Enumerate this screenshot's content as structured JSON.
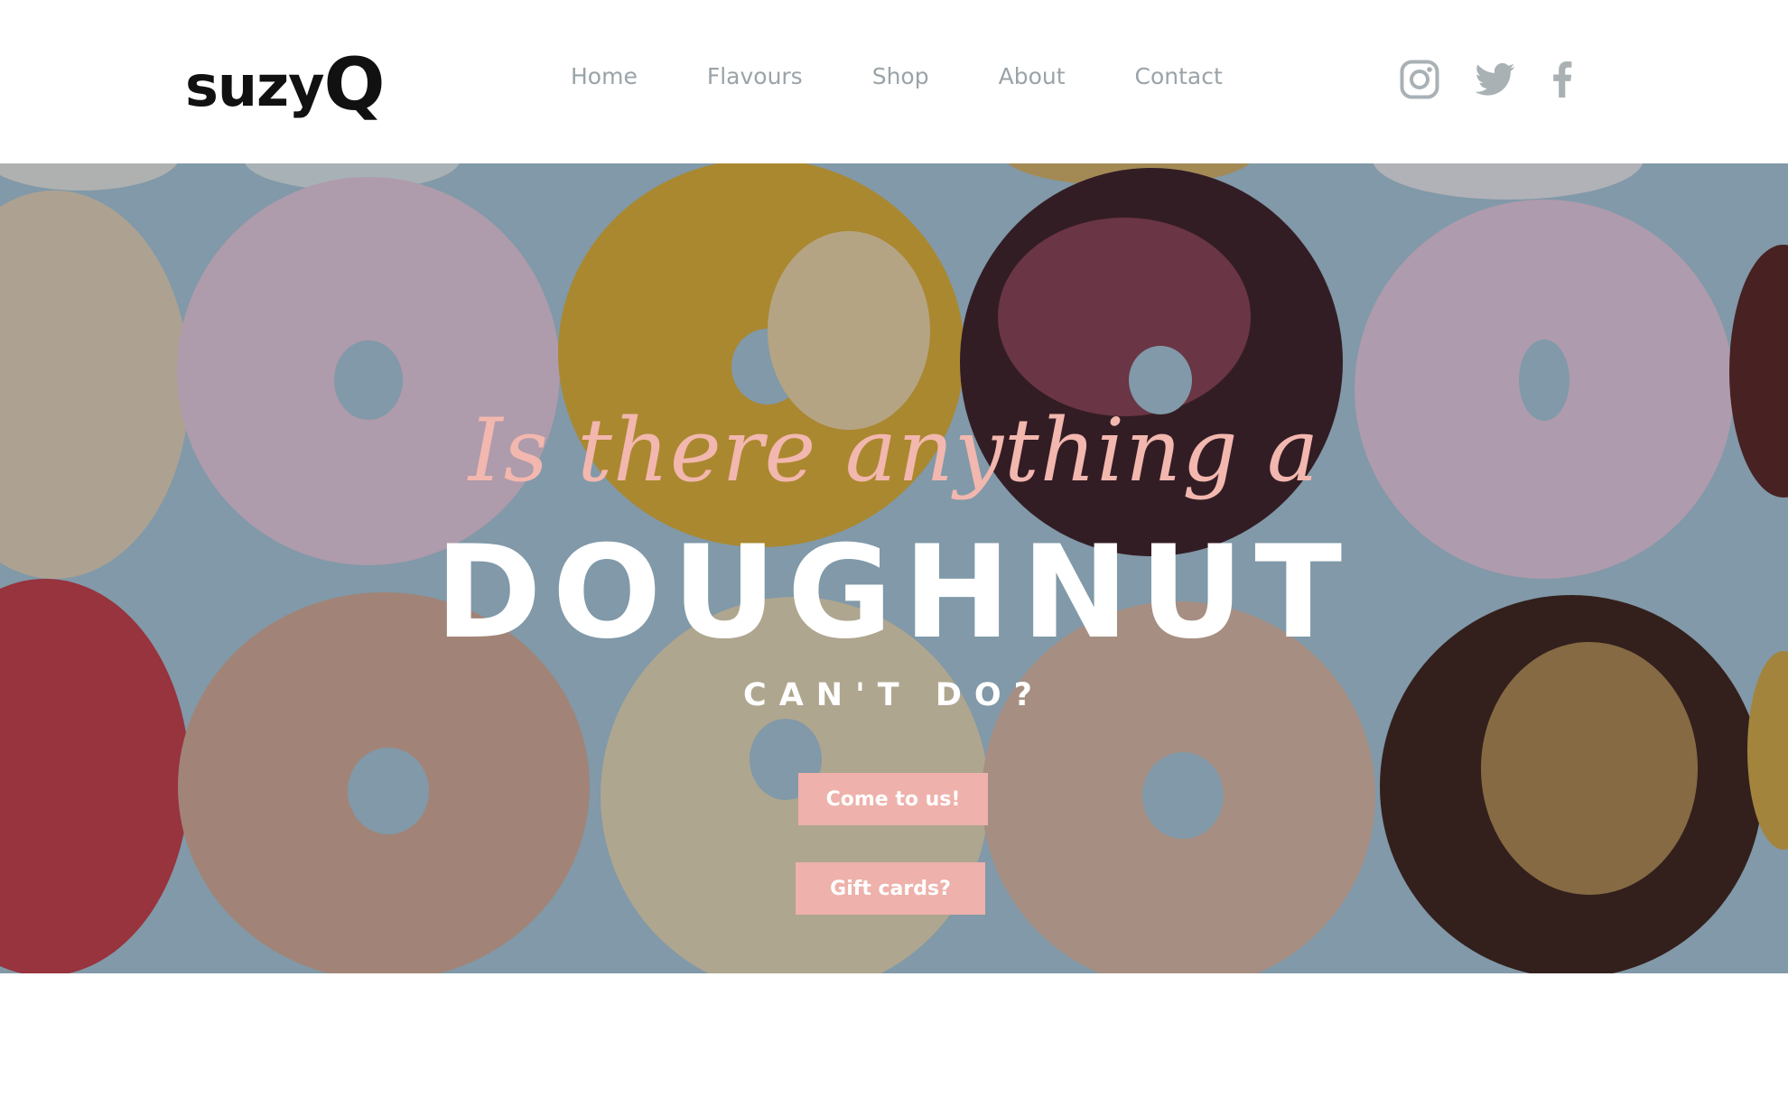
{
  "brand": {
    "logo_text": "suzy",
    "logo_accent": "Q"
  },
  "nav": {
    "items": [
      {
        "label": "Home"
      },
      {
        "label": "Flavours"
      },
      {
        "label": "Shop"
      },
      {
        "label": "About"
      },
      {
        "label": "Contact"
      }
    ]
  },
  "social": [
    {
      "icon": "instagram-icon"
    },
    {
      "icon": "twitter-icon"
    },
    {
      "icon": "facebook-icon"
    }
  ],
  "hero": {
    "script_text": "Is there anything a",
    "headline": "DOUGHNUT",
    "subline": "CAN'T DO?",
    "buttons": [
      {
        "label": "Come to us!"
      },
      {
        "label": "Gift cards?"
      }
    ]
  },
  "colors": {
    "accent_pink": "#eeb1ab",
    "script_pink": "#f2b7ae",
    "nav_gray": "#9aa3a8",
    "logo_black": "#111111",
    "hero_bg_blue": "#a9c5d4"
  }
}
